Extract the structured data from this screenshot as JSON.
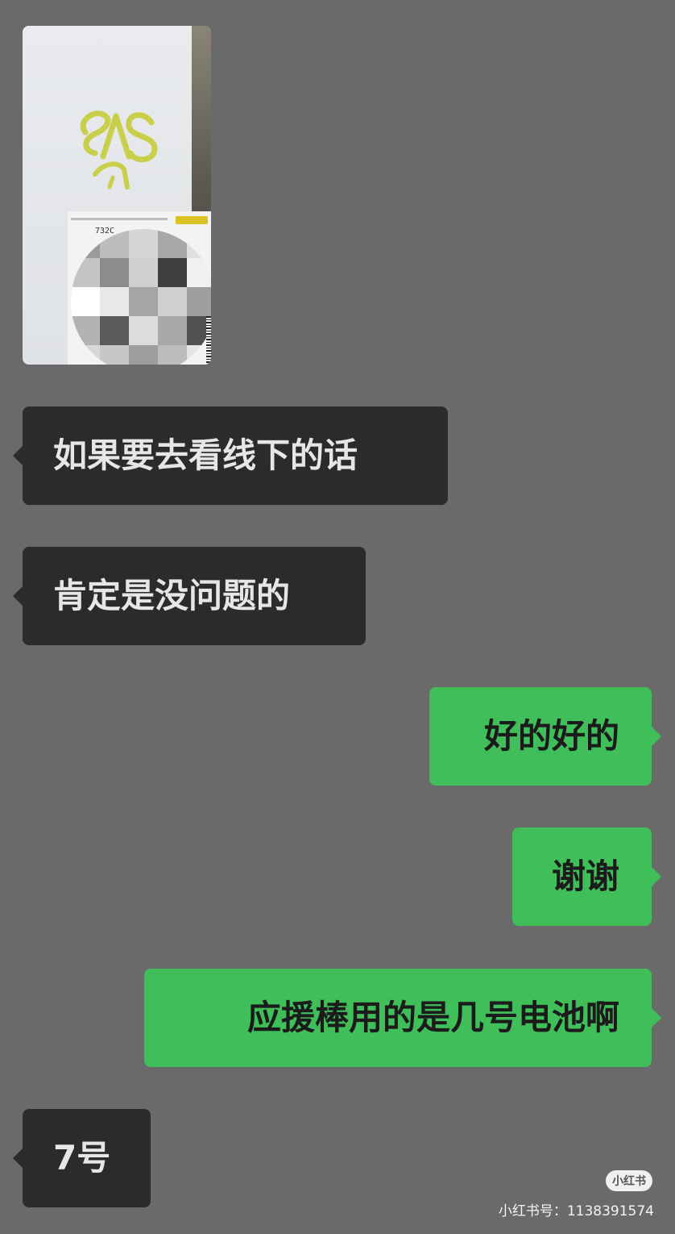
{
  "colors": {
    "background": "#6a6a6a",
    "incoming_bubble": "#2b2b2b",
    "outgoing_bubble": "#3fbe5a"
  },
  "photo_message": {
    "icon": "image-icon",
    "label_code": "732C"
  },
  "messages": [
    {
      "direction": "in",
      "text": "如果要去看线下的话"
    },
    {
      "direction": "in",
      "text": "肯定是没问题的"
    },
    {
      "direction": "out",
      "text": "好的好的"
    },
    {
      "direction": "out",
      "text": "谢谢"
    },
    {
      "direction": "out",
      "text": "应援棒用的是几号电池啊"
    },
    {
      "direction": "in",
      "text": "7号"
    }
  ],
  "watermark": {
    "badge": "小红书",
    "text": "小红书号：1138391574"
  }
}
